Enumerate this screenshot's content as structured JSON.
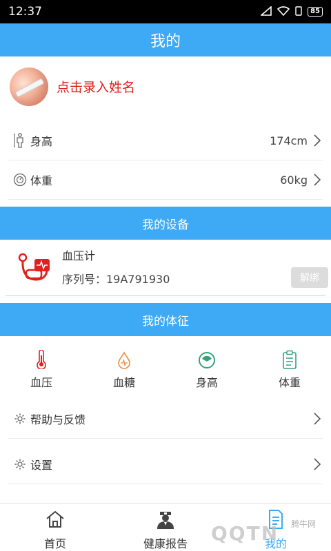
{
  "status_bar": {
    "time": "12:37",
    "battery": "85"
  },
  "header": {
    "title": "我的"
  },
  "profile": {
    "name_prompt": "点击录入姓名"
  },
  "metrics": [
    {
      "label": "身高",
      "value": "174cm"
    },
    {
      "label": "体重",
      "value": "60kg"
    }
  ],
  "devices_section": {
    "title": "我的设备"
  },
  "device": {
    "name": "血压计",
    "serial": "序列号：19A791930",
    "unbind_label": "解绑"
  },
  "vitals_section": {
    "title": "我的体征"
  },
  "vitals": [
    {
      "label": "血压"
    },
    {
      "label": "血糖"
    },
    {
      "label": "身高"
    },
    {
      "label": "体重"
    }
  ],
  "menu": [
    {
      "label": "帮助与反馈"
    },
    {
      "label": "设置"
    }
  ],
  "tabs": [
    {
      "label": "首页"
    },
    {
      "label": "健康报告"
    },
    {
      "label": "我的"
    }
  ],
  "watermark": {
    "main": "QQTN",
    "sub": "腾牛网"
  },
  "colors": {
    "primary": "#3ea9f5",
    "accent_red": "#e0211a",
    "orange": "#f28c3b",
    "green": "#36a27a"
  }
}
